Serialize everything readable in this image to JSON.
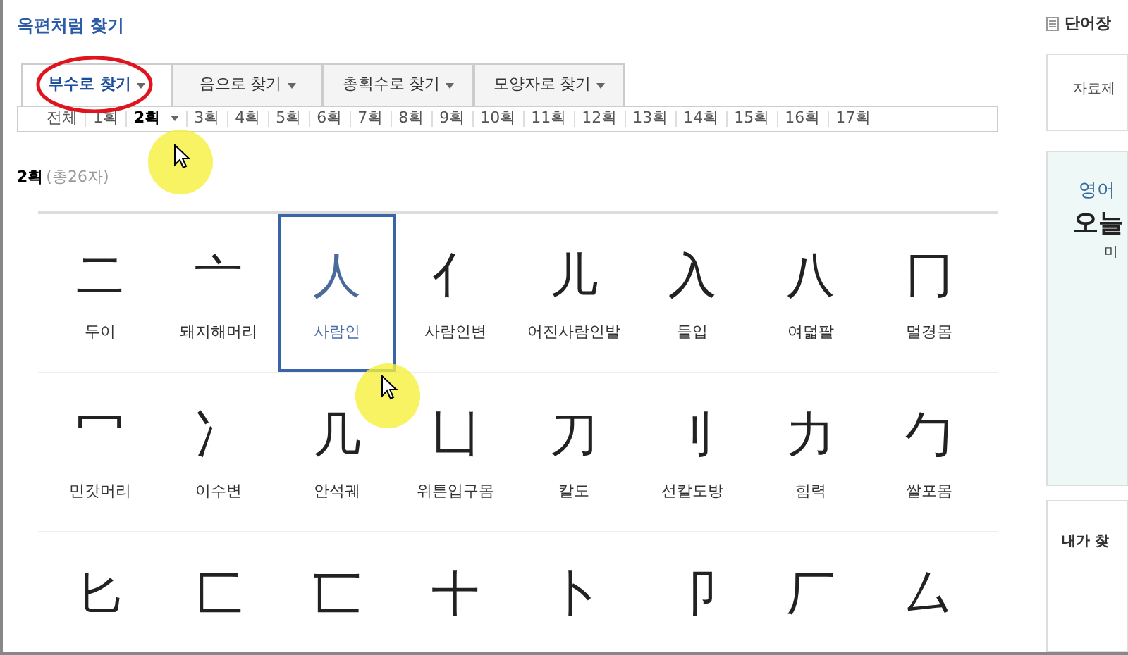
{
  "title": "옥편처럼 찾기",
  "tabs": [
    {
      "label": "부수로 찾기",
      "selected": true
    },
    {
      "label": "음으로 찾기",
      "selected": false
    },
    {
      "label": "총획수로 찾기",
      "selected": false
    },
    {
      "label": "모양자로 찾기",
      "selected": false
    }
  ],
  "strokes": [
    {
      "label": "전체",
      "selected": false
    },
    {
      "label": "1획",
      "selected": false
    },
    {
      "label": "2획",
      "selected": true
    },
    {
      "label": "3획",
      "selected": false
    },
    {
      "label": "4획",
      "selected": false
    },
    {
      "label": "5획",
      "selected": false
    },
    {
      "label": "6획",
      "selected": false
    },
    {
      "label": "7획",
      "selected": false
    },
    {
      "label": "8획",
      "selected": false
    },
    {
      "label": "9획",
      "selected": false
    },
    {
      "label": "10획",
      "selected": false
    },
    {
      "label": "11획",
      "selected": false
    },
    {
      "label": "12획",
      "selected": false
    },
    {
      "label": "13획",
      "selected": false
    },
    {
      "label": "14획",
      "selected": false
    },
    {
      "label": "15획",
      "selected": false
    },
    {
      "label": "16획",
      "selected": false
    },
    {
      "label": "17획",
      "selected": false
    }
  ],
  "result_heading": {
    "label": "2획",
    "count": "(총26자)"
  },
  "radicals": [
    {
      "char": "二",
      "name": "두이",
      "selected": false
    },
    {
      "char": "亠",
      "name": "돼지해머리",
      "selected": false
    },
    {
      "char": "人",
      "name": "사람인",
      "selected": true
    },
    {
      "char": "亻",
      "name": "사람인변",
      "selected": false
    },
    {
      "char": "儿",
      "name": "어진사람인발",
      "selected": false
    },
    {
      "char": "入",
      "name": "들입",
      "selected": false
    },
    {
      "char": "八",
      "name": "여덟팔",
      "selected": false
    },
    {
      "char": "冂",
      "name": "멀경몸",
      "selected": false
    },
    {
      "char": "冖",
      "name": "민갓머리",
      "selected": false
    },
    {
      "char": "冫",
      "name": "이수변",
      "selected": false
    },
    {
      "char": "几",
      "name": "안석궤",
      "selected": false
    },
    {
      "char": "凵",
      "name": "위튼입구몸",
      "selected": false
    },
    {
      "char": "刀",
      "name": "칼도",
      "selected": false
    },
    {
      "char": "刂",
      "name": "선칼도방",
      "selected": false
    },
    {
      "char": "力",
      "name": "힘력",
      "selected": false
    },
    {
      "char": "勹",
      "name": "쌀포몸",
      "selected": false
    },
    {
      "char": "匕",
      "selected": false
    },
    {
      "char": "匚",
      "selected": false
    },
    {
      "char": "匸",
      "selected": false
    },
    {
      "char": "十",
      "selected": false
    },
    {
      "char": "卜",
      "selected": false
    },
    {
      "char": "卩",
      "selected": false
    },
    {
      "char": "厂",
      "selected": false
    },
    {
      "char": "厶",
      "selected": false
    }
  ],
  "sidebar": {
    "wordbook": "단어장",
    "provider": "자료제",
    "promo_small": "영어",
    "promo_big": "오늘",
    "promo_sub": "미",
    "history": "내가 찾"
  }
}
